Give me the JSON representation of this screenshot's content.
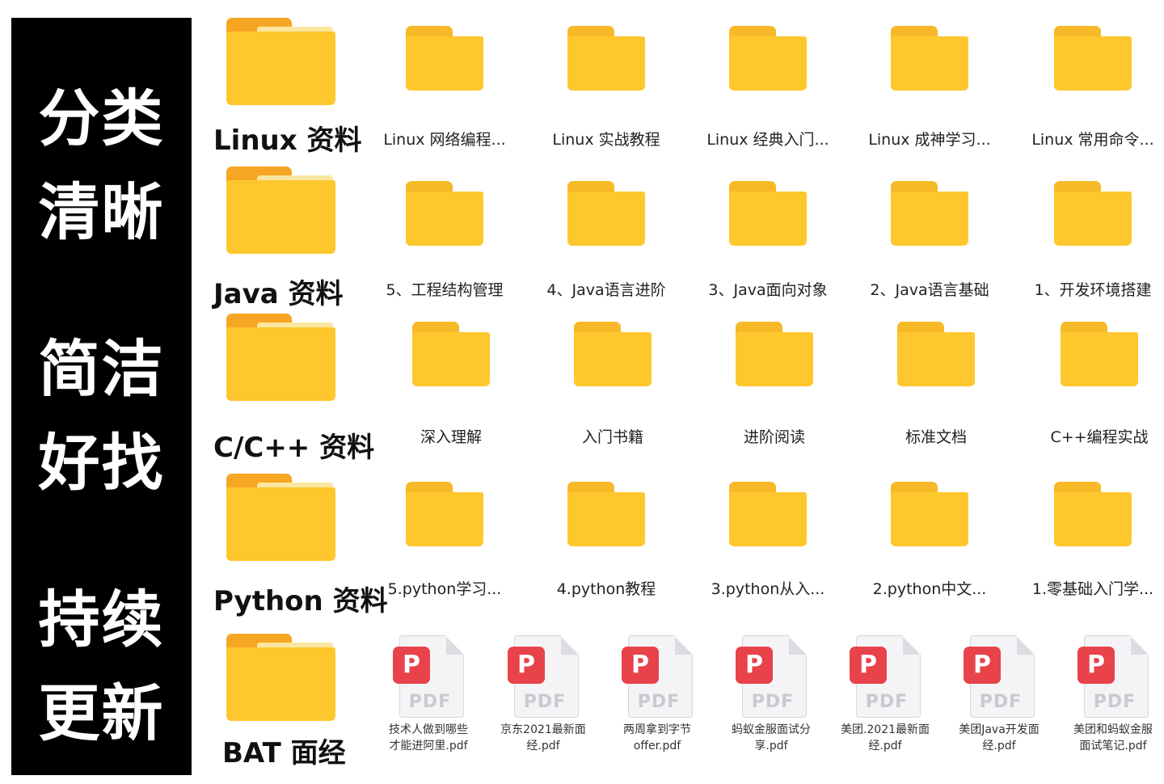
{
  "sidebar": {
    "slogans": [
      "分类",
      "清晰",
      "简洁",
      "好找",
      "持续",
      "更新"
    ]
  },
  "categories": [
    {
      "label": "Linux 资料",
      "items": [
        "Linux 网络编程...",
        "Linux 实战教程",
        "Linux 经典入门...",
        "Linux 成神学习...",
        "Linux 常用命令..."
      ]
    },
    {
      "label": "Java 资料",
      "items": [
        "5、工程结构管理",
        "4、Java语言进阶",
        "3、Java面向对象",
        "2、Java语言基础",
        "1、开发环境搭建"
      ]
    },
    {
      "label": "C/C++ 资料",
      "items": [
        "深入理解",
        "入门书籍",
        "进阶阅读",
        "标准文档",
        "C++编程实战"
      ]
    },
    {
      "label": "Python 资料",
      "items": [
        "5.python学习...",
        "4.python教程",
        "3.python从入...",
        "2.python中文...",
        "1.零基础入门学..."
      ]
    },
    {
      "label": "BAT 面经",
      "files": [
        {
          "line1": "技术人做到哪些",
          "line2": "才能进阿里.pdf"
        },
        {
          "line1": "京东2021最新面",
          "line2": "经.pdf"
        },
        {
          "line1": "两周拿到字节",
          "line2": "offer.pdf"
        },
        {
          "line1": "蚂蚁金服面试分",
          "line2": "享.pdf"
        },
        {
          "line1": "美团.2021最新面",
          "line2": "经.pdf"
        },
        {
          "line1": "美团Java开发面",
          "line2": "经.pdf"
        },
        {
          "line1": "美团和蚂蚁金服",
          "line2": "面试笔记.pdf"
        }
      ]
    }
  ],
  "pdf_icon": {
    "glyph": "P",
    "tag": "PDF",
    "badge_color": "#e8424a"
  },
  "colors": {
    "folder_front": "#fec72d",
    "folder_back": "#f6a623",
    "sidebar_bg": "#000000"
  }
}
